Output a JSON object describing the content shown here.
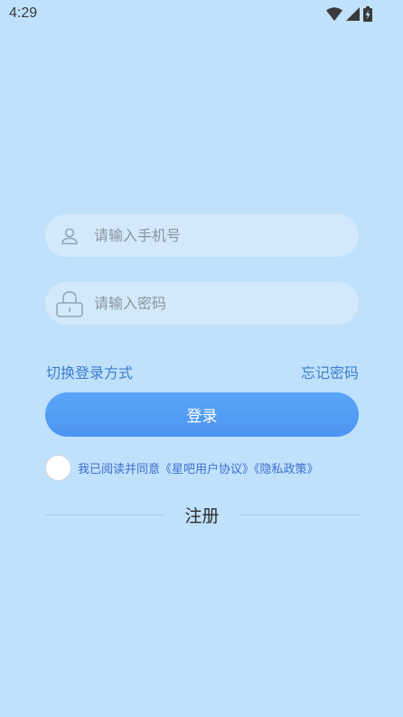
{
  "status_bar": {
    "time": "4:29",
    "icons": [
      "wifi-icon",
      "cellular-signal-icon",
      "battery-charging-icon"
    ]
  },
  "login_form": {
    "phone_placeholder": "请输入手机号",
    "phone_value": "",
    "phone_icon": "user-icon",
    "password_placeholder": "请输入密码",
    "password_value": "",
    "password_icon": "lock-icon",
    "switch_login_label": "切换登录方式",
    "forgot_password_label": "忘记密码",
    "login_button_label": "登录",
    "agreement_text": "我已阅读并同意《星吧用户协议》《隐私政策》",
    "agreement_checked": false,
    "register_label": "注册"
  },
  "colors": {
    "background": "#bfe1fb",
    "field_background": "#d3e9fb",
    "link": "#3f7ecf",
    "button_top": "#5aa6f8",
    "button_bottom": "#4d94f3"
  }
}
